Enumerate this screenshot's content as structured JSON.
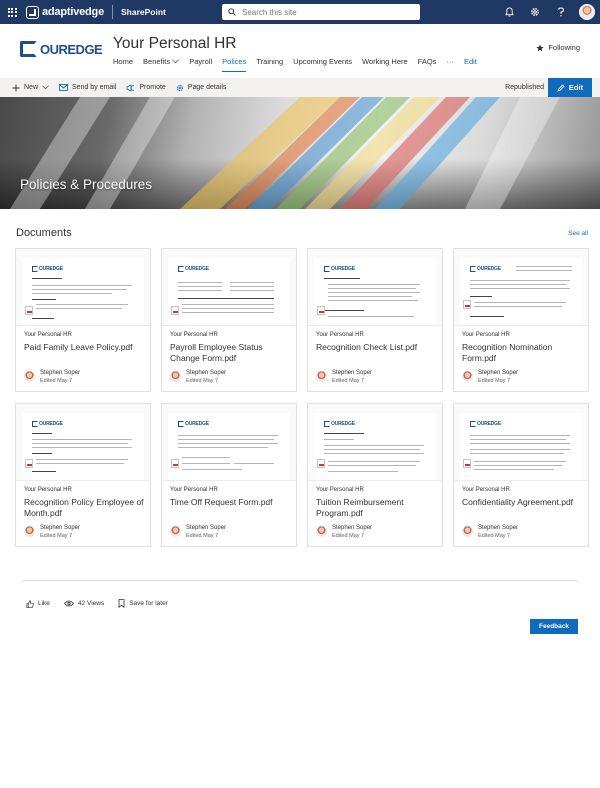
{
  "suite": {
    "brand": "adaptivedge",
    "app": "SharePoint",
    "search_placeholder": "Search this site",
    "icons": [
      "waffle-icon",
      "bell-icon",
      "gear-icon",
      "help-icon",
      "avatar"
    ]
  },
  "site": {
    "logo_text": "OUREDGE",
    "title": "Your Personal HR",
    "nav": [
      "Home",
      "Benefits",
      "Payroll",
      "Polices",
      "Training",
      "Upcoming Events",
      "Working Here",
      "FAQs",
      "···",
      "Edit"
    ],
    "active_nav": "Polices",
    "follow_label": "Following"
  },
  "commandbar": {
    "new_label": "New",
    "send_label": "Send by email",
    "promote_label": "Promote",
    "details_label": "Page details",
    "status": "Republished",
    "edit_label": "Edit"
  },
  "hero": {
    "title": "Policies & Procedures"
  },
  "documents": {
    "heading": "Documents",
    "see_all": "See all",
    "items": [
      {
        "site": "Your Personal HR",
        "title": "Paid Family Leave Policy.pdf",
        "author": "Stephen Soper",
        "edited": "Edited May 7"
      },
      {
        "site": "Your Personal HR",
        "title": "Payroll Employee Status Change Form.pdf",
        "author": "Stephen Soper",
        "edited": "Edited May 7"
      },
      {
        "site": "Your Personal HR",
        "title": "Recognition Check List.pdf",
        "author": "Stephen Soper",
        "edited": "Edited May 7"
      },
      {
        "site": "Your Personal HR",
        "title": "Recognition Nomination Form.pdf",
        "author": "Stephen Soper",
        "edited": "Edited May 7"
      },
      {
        "site": "Your Personal HR",
        "title": "Recognition Policy Employee of Month.pdf",
        "author": "Stephen Soper",
        "edited": "Edited May 7"
      },
      {
        "site": "Your Personal HR",
        "title": "Time Off Request Form.pdf",
        "author": "Stephen Soper",
        "edited": "Edited May 7"
      },
      {
        "site": "Your Personal HR",
        "title": "Tuition Reimbursement Program.pdf",
        "author": "Stephen Soper",
        "edited": "Edited May 7"
      },
      {
        "site": "Your Personal HR",
        "title": "Confidentiality Agreement.pdf",
        "author": "Stephen Soper",
        "edited": "Edited May 7"
      }
    ]
  },
  "footer": {
    "like_label": "Like",
    "views_label": "42 Views",
    "save_label": "Save for later",
    "feedback_label": "Feedback"
  },
  "colors": {
    "suite_bar": "#1f3864",
    "accent": "#0f6cbd",
    "logo": "#1f4e8c",
    "command_bar": "#f3f2f1"
  }
}
